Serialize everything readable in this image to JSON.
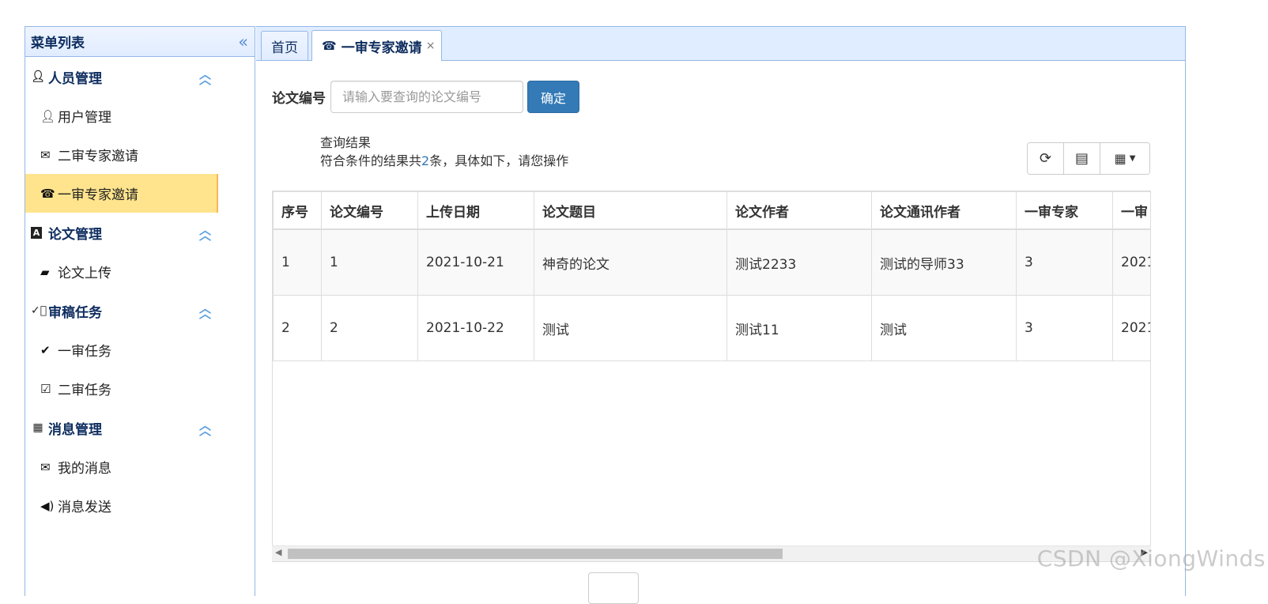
{
  "sidebar": {
    "title": "菜单列表",
    "collapse_icon": "double-chevron-left-icon",
    "groups": [
      {
        "label": "人员管理",
        "icon": "user-icon",
        "items": [
          {
            "label": "用户管理",
            "icon": "user-icon"
          },
          {
            "label": "二审专家邀请",
            "icon": "envelope-icon"
          },
          {
            "label": "一审专家邀请",
            "icon": "phone-icon",
            "active": true
          }
        ]
      },
      {
        "label": "论文管理",
        "icon": "font-icon",
        "items": [
          {
            "label": "论文上传",
            "icon": "folder-open-icon"
          }
        ]
      },
      {
        "label": "审稿任务",
        "icon": "check-circle-icon",
        "items": [
          {
            "label": "一审任务",
            "icon": "checkmark-icon"
          },
          {
            "label": "二审任务",
            "icon": "check-square-icon"
          }
        ]
      },
      {
        "label": "消息管理",
        "icon": "th-large-icon",
        "items": [
          {
            "label": "我的消息",
            "icon": "envelope-icon"
          },
          {
            "label": "消息发送",
            "icon": "volume-icon"
          }
        ]
      }
    ]
  },
  "tabs": [
    {
      "label": "首页"
    },
    {
      "label": "一审专家邀请",
      "icon": "phone-icon",
      "close": "×",
      "active": true
    }
  ],
  "search": {
    "label": "论文编号",
    "placeholder": "请输入要查询的论文编号",
    "value": "",
    "confirm_label": "确定"
  },
  "result": {
    "title": "查询结果",
    "summary_prefix": "符合条件的结果共",
    "count": "2",
    "summary_suffix": "条，具体如下，请您操作"
  },
  "toolbar": {
    "refresh_icon": "refresh-icon",
    "toggle_view_icon": "list-alt-icon",
    "columns_icon": "th-columns-icon"
  },
  "table": {
    "headers": [
      "序号",
      "论文编号",
      "上传日期",
      "论文题目",
      "论文作者",
      "论文通讯作者",
      "一审专家",
      "一审"
    ],
    "rows": [
      [
        "1",
        "1",
        "2021-10-21",
        "神奇的论文",
        "测试2233",
        "测试的导师33",
        "3",
        "2021"
      ],
      [
        "2",
        "2",
        "2021-10-22",
        "测试",
        "测试11",
        "测试",
        "3",
        "2021"
      ]
    ]
  },
  "watermark": "CSDN @XiongWinds"
}
